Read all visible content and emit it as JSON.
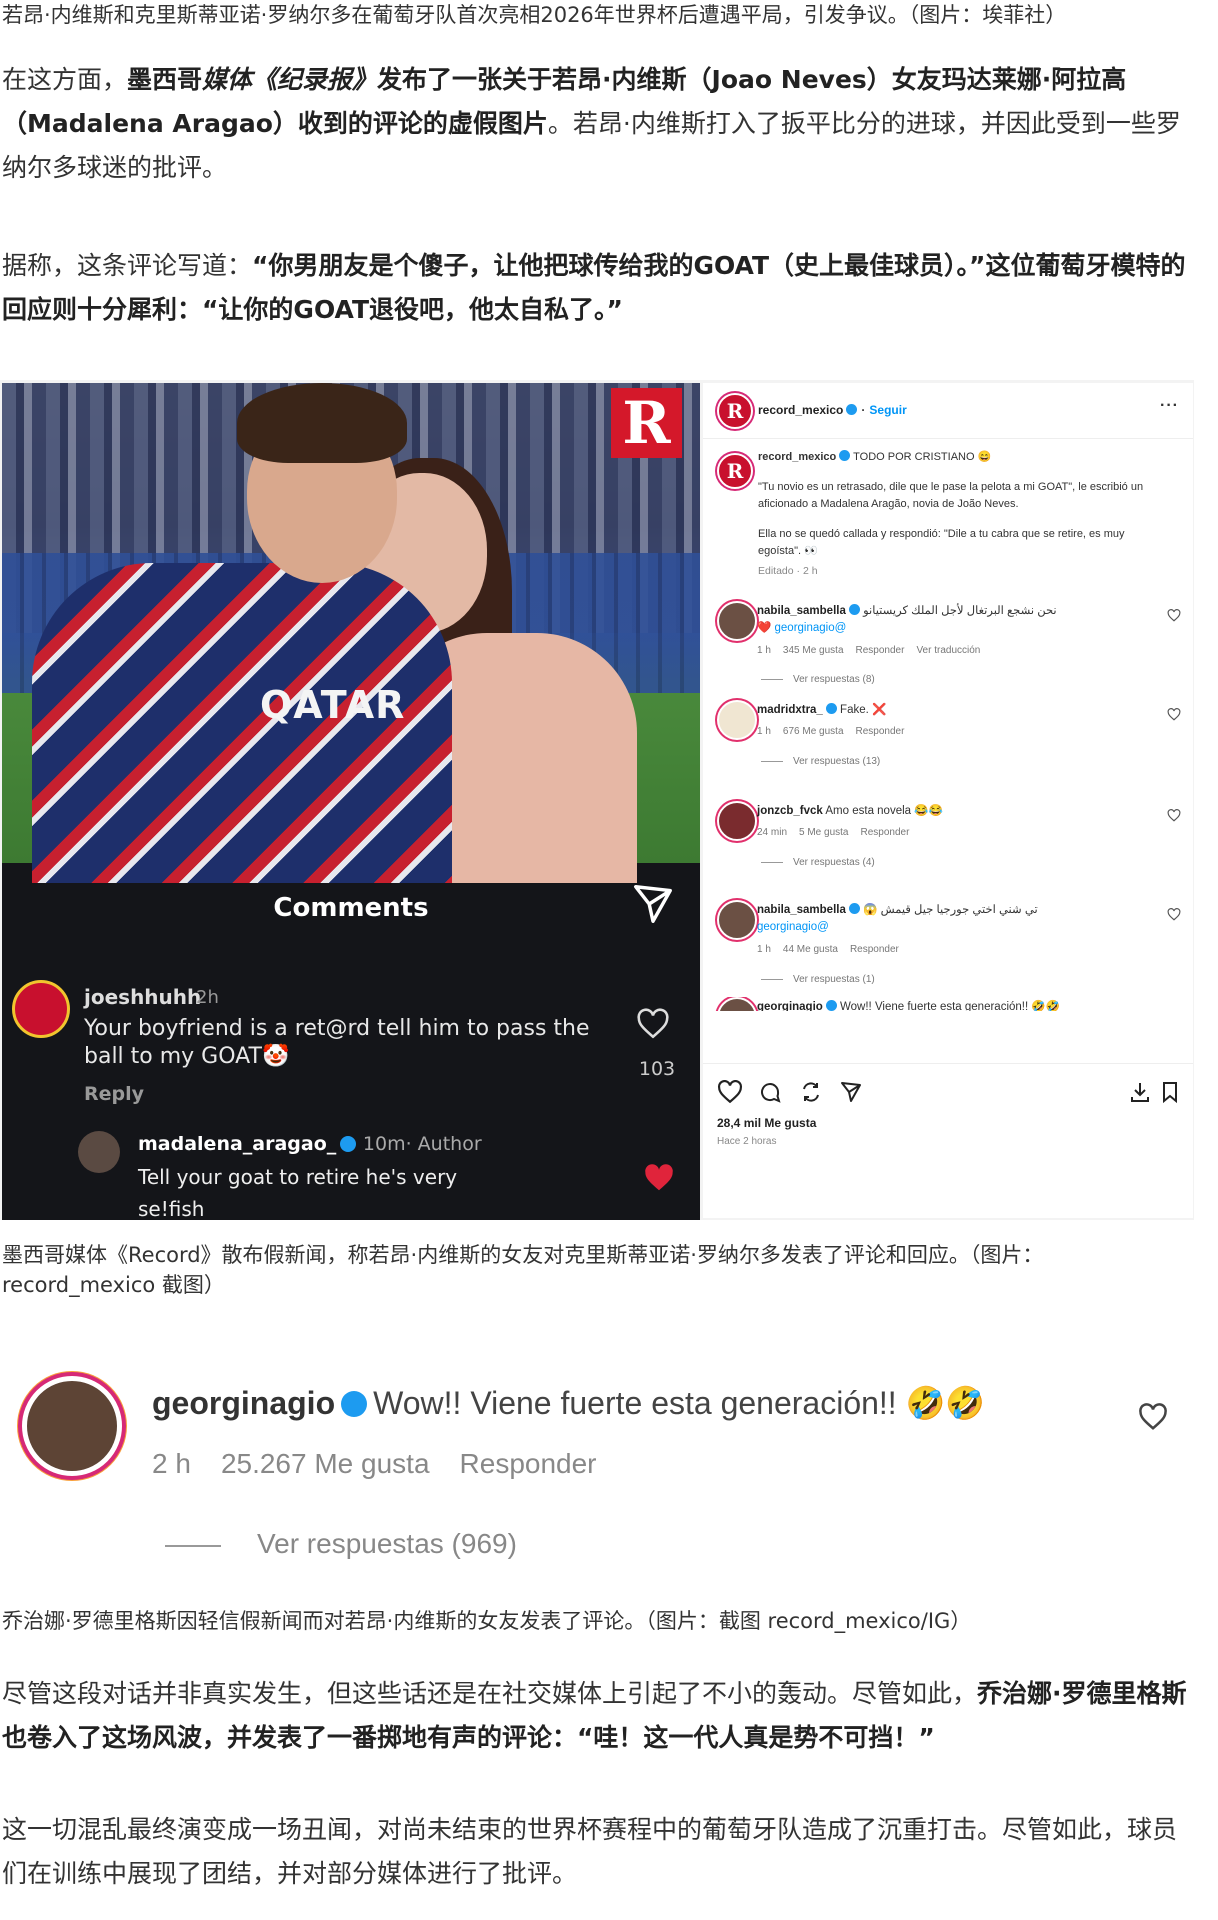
{
  "caption_top": "若昂·内维斯和克里斯蒂亚诺·罗纳尔多在葡萄牙队首次亮相2026年世界杯后遭遇平局，引发争议。（图片：埃菲社）",
  "para1": {
    "a": "在这方面，",
    "b1": "墨西哥",
    "b2": "媒体《纪录报》",
    "b3": "发布了一张关于若昂·内维斯（Joao Neves）女友玛达莱娜·阿拉高（Madalena Aragao）收到的评论的虚假图片",
    "c": "。若昂·内维斯打入了扳平比分的进球，并因此受到一些罗纳尔多球迷的批评。"
  },
  "para2": {
    "a": "据称，这条评论写道：",
    "b": "“你男朋友是个傻子，让他把球传给我的GOAT（史上最佳球员）。”这位葡萄牙模特的回应则十分犀利：“让你的GOAT退役吧，他太自私了。”"
  },
  "photo": {
    "logo": "R",
    "jersey_text": "QATAR",
    "comments_title": "Comments",
    "comment": {
      "user": "joeshhuhh",
      "time": "2h",
      "text": "Your boyfriend is a ret@rd tell him to pass the ball to my GOAT🤡",
      "reply": "Reply",
      "likes": "103"
    },
    "reply_comment": {
      "user": "madalena_aragao_",
      "meta": "10m· Author",
      "text": "Tell your goat to retire he's very se!fish"
    }
  },
  "instagram": {
    "account": "record_mexico",
    "follow": "Seguir",
    "more": "···",
    "caption_header": "TODO POR CRISTIANO 😄",
    "caption_body": "\"Tu novio es un retrasado, dile que le pase la pelota a mi GOAT\", le escribió un aficionado a Madalena Aragão, novia de João Neves.",
    "caption_body2": "Ella no se quedó callada y respondió: \"Dile a tu cabra que se retire, es muy egoísta\". 👀",
    "edited": "Editado · 2 h",
    "comments": [
      {
        "user": "nabila_sambella",
        "text": "نحن نشجع البرتغال لأجل الملك كريستيانو",
        "mention": "❤️ georginagio@",
        "time": "1 h",
        "likes": "345 Me gusta",
        "reply": "Responder",
        "translate": "Ver traducción",
        "more": "Ver respuestas (8)"
      },
      {
        "user": "madridxtra_",
        "text": "Fake. ❌",
        "mention": "",
        "time": "1 h",
        "likes": "676 Me gusta",
        "reply": "Responder",
        "translate": "",
        "more": "Ver respuestas (13)"
      },
      {
        "user": "jonzcb_fvck",
        "text": "Amo esta novela 😂😂",
        "mention": "",
        "time": "24 min",
        "likes": "5 Me gusta",
        "reply": "Responder",
        "translate": "",
        "more": "Ver respuestas (4)"
      },
      {
        "user": "nabila_sambella",
        "text": "😱 تي شني اختي جورجيا جيل قيمش",
        "mention": "georginagio@",
        "time": "1 h",
        "likes": "44 Me gusta",
        "reply": "Responder",
        "translate": "",
        "more": "Ver respuestas (1)"
      },
      {
        "user": "georginagio",
        "text": "Wow!! Viene fuerte esta generación!! 🤣🤣",
        "mention": "",
        "time": "",
        "likes": "",
        "reply": "",
        "translate": "",
        "more": ""
      }
    ],
    "likes_total": "28,4 mil Me gusta",
    "posted": "Hace 2 horas"
  },
  "caption_mid": "墨西哥媒体《Record》散布假新闻，称若昂·内维斯的女友对克里斯蒂亚诺·罗纳尔多发表了评论和回应。（图片：record_mexico 截图）",
  "georgina": {
    "user": "georginagio",
    "text": "Wow!! Viene fuerte esta generación!! 🤣🤣",
    "time": "2 h",
    "likes": "25.267 Me gusta",
    "reply": "Responder",
    "more": "Ver respuestas (969)"
  },
  "caption_bottom": "乔治娜·罗德里格斯因轻信假新闻而对若昂·内维斯的女友发表了评论。（图片：截图 record_mexico/IG）",
  "para3": {
    "a": "尽管这段对话并非真实发生，但这些话还是在社交媒体上引起了不小的轰动。尽管如此，",
    "b": "乔治娜·罗德里格斯也卷入了这场风波，并发表了一番掷地有声的评论：“哇！这一代人真是势不可挡！”"
  },
  "para4": "这一切混乱最终演变成一场丑闻，对尚未结束的世界杯赛程中的葡萄牙队造成了沉重打击。尽管如此，球员们在训练中展现了团结，并对部分媒体进行了批评。",
  "colors": {
    "instagram_blue": "#0095f6",
    "record_red": "#d4182a",
    "like_red": "#e0243b"
  }
}
